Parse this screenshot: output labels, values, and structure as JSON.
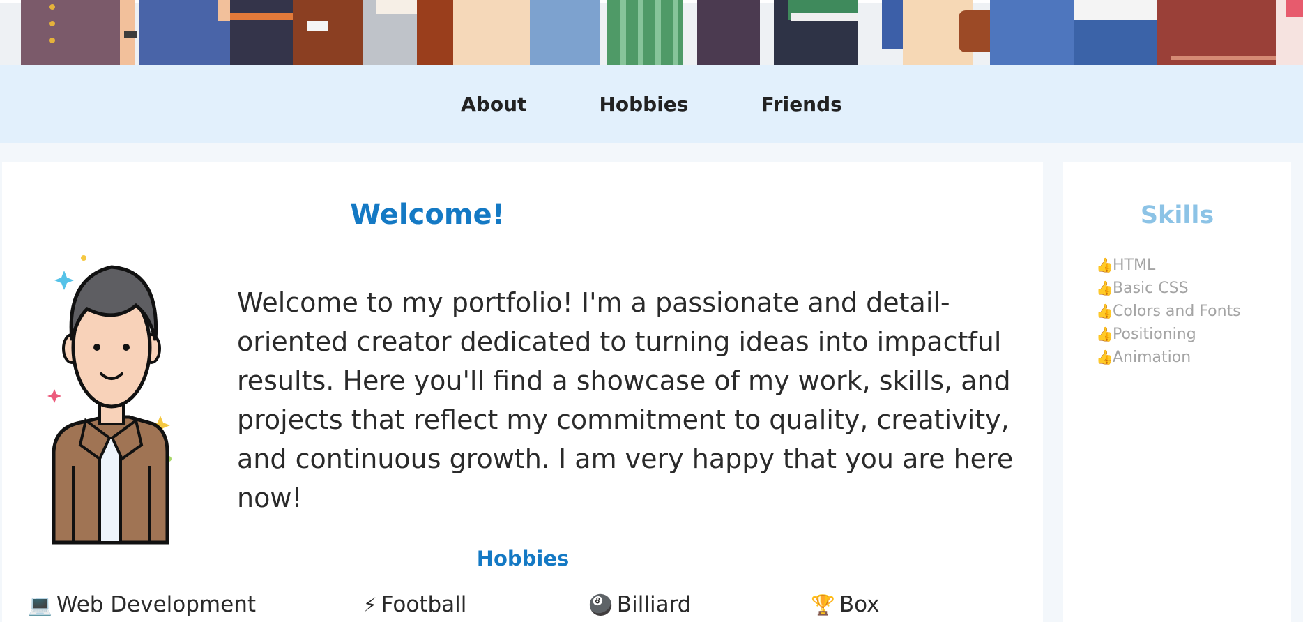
{
  "nav": {
    "items": [
      {
        "label": "About"
      },
      {
        "label": "Hobbies"
      },
      {
        "label": "Friends"
      }
    ]
  },
  "main": {
    "title": "Welcome!",
    "intro": "Welcome to my portfolio! I'm a passionate and detail-oriented creator dedicated to turning ideas into impactful results. Here you'll find a showcase of my work, skills, and projects that reflect my commitment to quality, creativity, and continuous growth. I am very happy that you are here now!",
    "hobbies_title": "Hobbies",
    "hobbies": [
      {
        "icon": "💻",
        "icon_name": "laptop-icon",
        "label": "Web Development"
      },
      {
        "icon": "⚡",
        "icon_name": "lightning-icon",
        "label": "Football"
      },
      {
        "icon": "🎱",
        "icon_name": "billiard-ball-icon",
        "label": "Billiard"
      },
      {
        "icon": "🏆",
        "icon_name": "trophy-icon",
        "label": "Box"
      }
    ]
  },
  "sidebar": {
    "title": "Skills",
    "skills": [
      {
        "icon": "👍",
        "label": "HTML"
      },
      {
        "icon": "👍",
        "label": "Basic CSS"
      },
      {
        "icon": "👍",
        "label": "Colors and Fonts"
      },
      {
        "icon": "👍",
        "label": "Positioning"
      },
      {
        "icon": "👍",
        "label": "Animation"
      }
    ]
  },
  "colors": {
    "accent": "#1479c4",
    "skills_title": "#8cc3e6",
    "nav_bg": "#e2f0fc",
    "page_bg": "#f3f7fb"
  }
}
